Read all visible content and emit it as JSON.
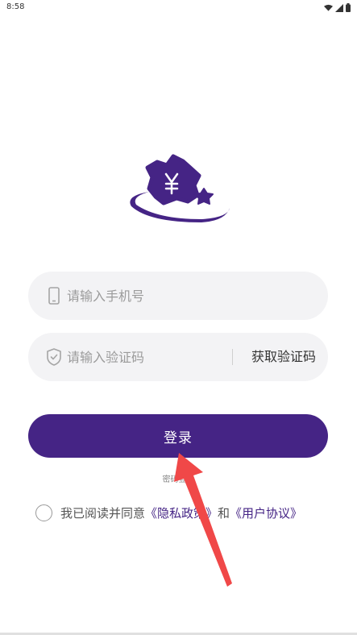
{
  "status_bar": {
    "time": "8:58",
    "icons": [
      "wifi-icon",
      "signal-icon",
      "battery-icon"
    ]
  },
  "login_form": {
    "phone": {
      "placeholder": "请输入手机号",
      "icon": "phone-icon"
    },
    "code": {
      "placeholder": "请输入验证码",
      "icon": "shield-icon",
      "get_code_label": "获取验证码"
    },
    "login_label": "登录",
    "alt_login_label": "密码登录"
  },
  "agreement": {
    "prefix": "我已阅读并同意",
    "privacy_link": "《隐私政策》",
    "and": "和",
    "terms_link": "《用户协议》"
  },
  "colors": {
    "brand": "#452485",
    "input_bg": "#f3f3f5",
    "annotation_arrow": "#f04848"
  }
}
